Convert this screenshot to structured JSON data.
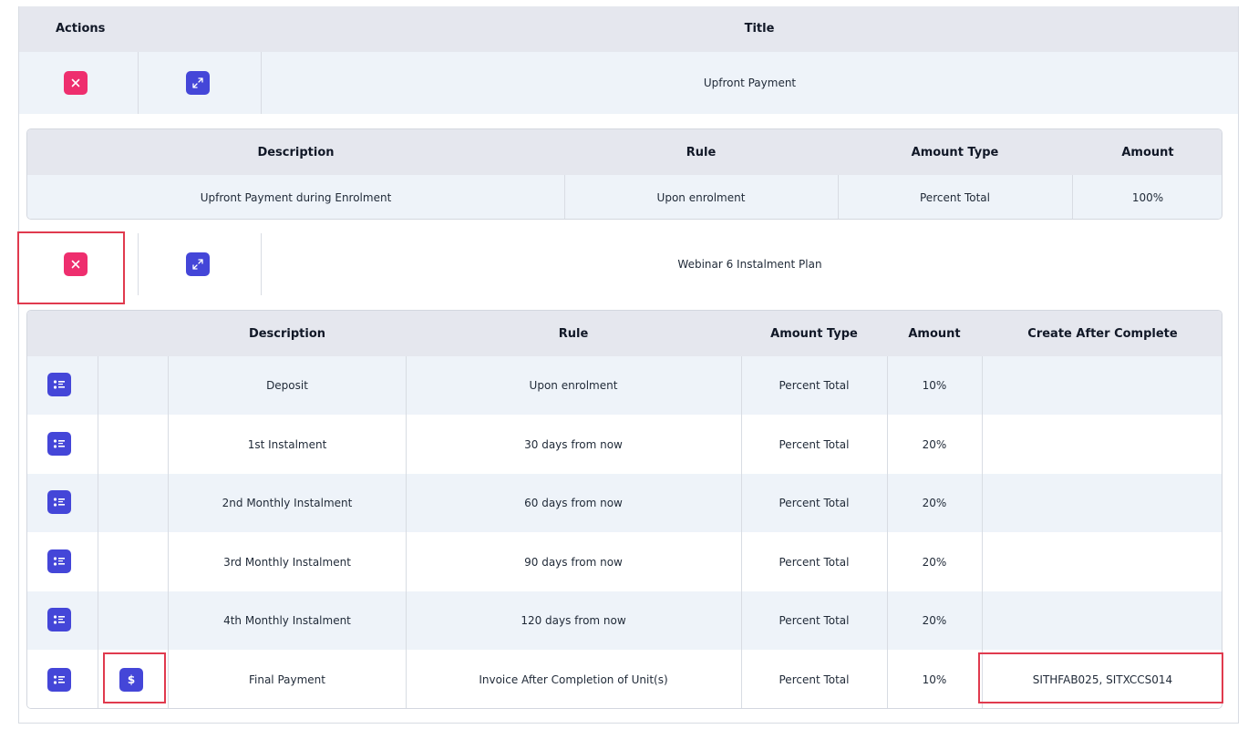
{
  "plans_table": {
    "headers": {
      "actions": "Actions",
      "title": "Title"
    }
  },
  "plans": [
    {
      "title": "Upfront Payment",
      "delete_glyph": "×",
      "expand_glyph": "⤢",
      "schedule": {
        "headers": [
          "Description",
          "Rule",
          "Amount Type",
          "Amount"
        ],
        "rows": [
          {
            "description": "Upfront Payment during Enrolment",
            "rule": "Upon enrolment",
            "amount_type": "Percent Total",
            "amount": "100%"
          }
        ]
      }
    },
    {
      "title": "Webinar 6 Instalment Plan",
      "delete_glyph": "×",
      "expand_glyph": "⤢",
      "schedule": {
        "headers": [
          "Description",
          "Rule",
          "Amount Type",
          "Amount",
          "Create After Complete"
        ],
        "rows": [
          {
            "description": "Deposit",
            "rule": "Upon enrolment",
            "amount_type": "Percent Total",
            "amount": "10%",
            "create_after_complete": ""
          },
          {
            "description": "1st Instalment",
            "rule": "30 days from now",
            "amount_type": "Percent Total",
            "amount": "20%",
            "create_after_complete": ""
          },
          {
            "description": "2nd Monthly Instalment",
            "rule": "60 days from now",
            "amount_type": "Percent Total",
            "amount": "20%",
            "create_after_complete": ""
          },
          {
            "description": "3rd Monthly Instalment",
            "rule": "90 days from now",
            "amount_type": "Percent Total",
            "amount": "20%",
            "create_after_complete": ""
          },
          {
            "description": "4th Monthly Instalment",
            "rule": "120 days from now",
            "amount_type": "Percent Total",
            "amount": "20%",
            "create_after_complete": ""
          },
          {
            "description": "Final Payment",
            "rule": "Invoice After Completion of Unit(s)",
            "amount_type": "Percent Total",
            "amount": "10%",
            "create_after_complete": "SITHFAB025, SITXCCS014",
            "dollar_glyph": "$"
          }
        ]
      }
    }
  ],
  "icons": {
    "delete": "close-icon",
    "expand": "expand-icon",
    "list": "list-icon",
    "invoice": "dollar-icon"
  },
  "colors": {
    "delete_button": "#ee2e6e",
    "action_button": "#4446d8",
    "header_bg": "#e5e7ee",
    "row_alt_bg": "#eef3f9",
    "highlight": "#e03a4e"
  }
}
